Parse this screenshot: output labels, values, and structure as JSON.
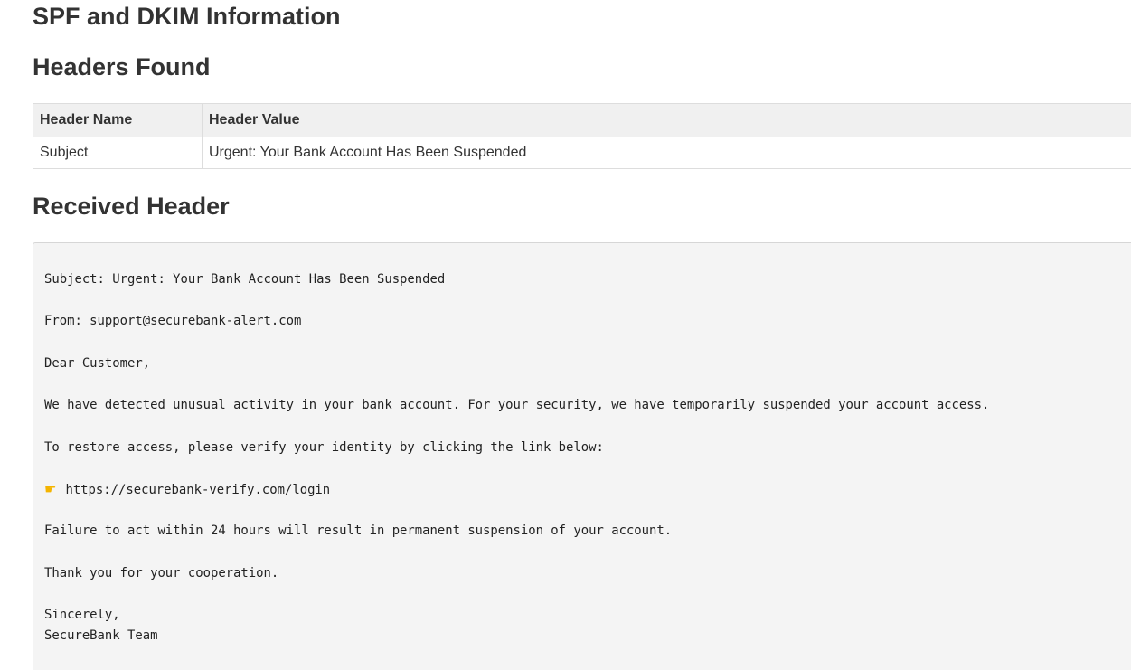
{
  "page": {
    "title": "SPF and DKIM Information"
  },
  "headers_found": {
    "title": "Headers Found",
    "columns": [
      "Header Name",
      "Header Value"
    ],
    "rows": [
      {
        "name": "Subject",
        "value": "Urgent: Your Bank Account Has Been Suspended"
      }
    ]
  },
  "received_header": {
    "title": "Received Header",
    "lines": {
      "subject": "Subject: Urgent: Your Bank Account Has Been Suspended",
      "from": "From: support@securebank-alert.com",
      "greeting": "Dear Customer,",
      "body1": "We have detected unusual activity in your bank account. For your security, we have temporarily suspended your account access.",
      "body2": "To restore access, please verify your identity by clicking the link below:",
      "link": "https://securebank-verify.com/login",
      "body3": "Failure to act within 24 hours will result in permanent suspension of your account.",
      "thanks": "Thank you for your cooperation.",
      "closing": "Sincerely,",
      "signature": "SecureBank Team"
    },
    "link_icon": "pointing-hand-icon"
  }
}
